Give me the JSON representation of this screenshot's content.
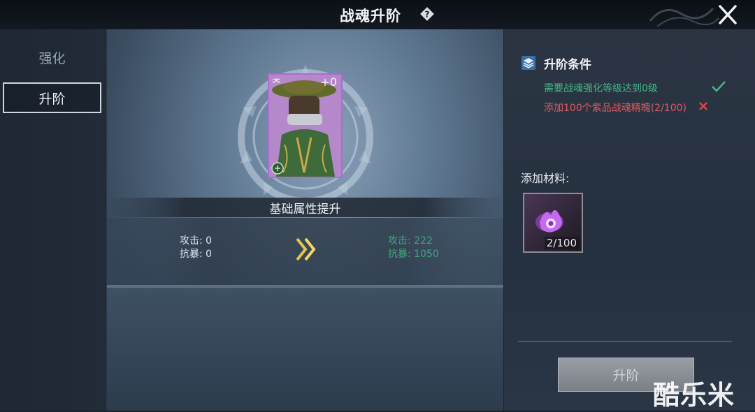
{
  "header": {
    "title": "战魂升阶"
  },
  "sidebar": {
    "tabs": [
      {
        "label": "强化"
      },
      {
        "label": "升阶"
      }
    ]
  },
  "card": {
    "rank": "ᄌ",
    "level": "+0"
  },
  "stats": {
    "header": "基础属性提升",
    "current": [
      "攻击: 0",
      "抗暴: 0"
    ],
    "next": [
      "攻击: 222",
      "抗暴: 1050"
    ]
  },
  "conditions": {
    "title": "升阶条件",
    "items": [
      {
        "text": "需要战魂强化等级达到0级",
        "met": true
      },
      {
        "text": "添加100个紫品战魂精魄(2/100)",
        "met": false
      }
    ]
  },
  "materials": {
    "label": "添加材料:",
    "slot_count": "2/100"
  },
  "actions": {
    "advance_label": "升阶"
  },
  "watermark": "酷乐米",
  "colors": {
    "met": "#45b787",
    "unmet": "#e05a60",
    "stat_gain": "#3fa97c",
    "card_border": "#b06ad3"
  }
}
